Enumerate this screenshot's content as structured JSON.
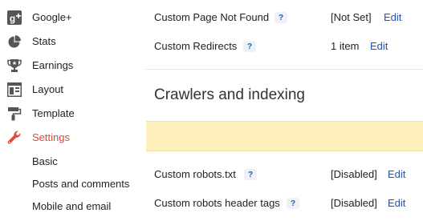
{
  "sidebar": {
    "items": [
      {
        "label": "Google+",
        "icon": "google-plus-icon"
      },
      {
        "label": "Stats",
        "icon": "pie-chart-icon"
      },
      {
        "label": "Earnings",
        "icon": "trophy-icon"
      },
      {
        "label": "Layout",
        "icon": "layout-icon"
      },
      {
        "label": "Template",
        "icon": "paint-roller-icon"
      },
      {
        "label": "Settings",
        "icon": "wrench-icon",
        "active": true
      }
    ],
    "subitems": [
      "Basic",
      "Posts and comments",
      "Mobile and email"
    ]
  },
  "main": {
    "rows_top": [
      {
        "label": "Custom Page Not Found",
        "value": "[Not Set]",
        "edit": "Edit"
      },
      {
        "label": "Custom Redirects",
        "value": "1 item",
        "edit": "Edit"
      }
    ],
    "section_heading": "Crawlers and indexing",
    "rows_bottom": [
      {
        "label": "Custom robots.txt",
        "value": "[Disabled]",
        "edit": "Edit"
      },
      {
        "label": "Custom robots header tags",
        "value": "[Disabled]",
        "edit": "Edit"
      }
    ],
    "help_glyph": "?"
  },
  "colors": {
    "active": "#dd4b39",
    "link": "#1155cc",
    "notice_bg": "#fff1bd",
    "icon_gray": "#555555"
  }
}
